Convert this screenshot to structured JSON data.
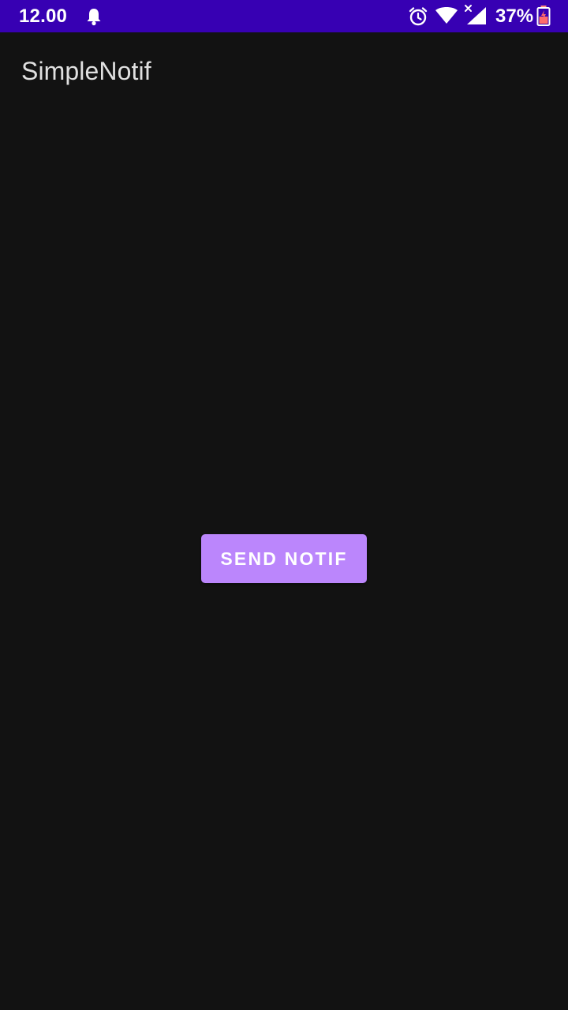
{
  "status_bar": {
    "time": "12.00",
    "battery_percent": "37%",
    "icons": [
      "bell-icon",
      "alarm-icon",
      "wifi-icon",
      "cell-signal-icon",
      "battery-icon"
    ],
    "background_color": "#3700B3"
  },
  "app_bar": {
    "title": "SimpleNotif"
  },
  "main": {
    "send_button_label": "SEND NOTIF",
    "button_color": "#BB86FC",
    "background_color": "#121212"
  }
}
